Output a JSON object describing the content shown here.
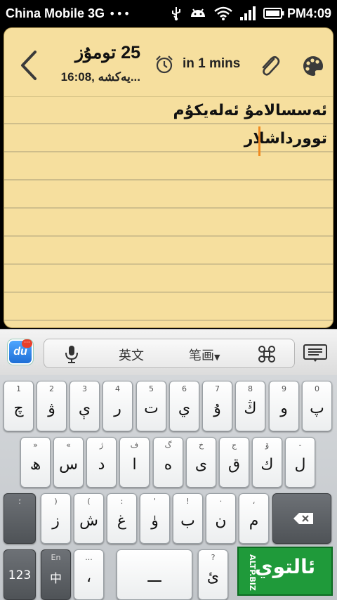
{
  "status_bar": {
    "carrier": "China Mobile 3G",
    "dots": "•••",
    "time": "PM4:09"
  },
  "note": {
    "date_day": "25 تومۇز",
    "date_sub": "16:08, يەكشە...",
    "reminder": "in 1 mins",
    "lines": [
      "ئەسسالامۇ ئەلەيكۇم",
      "توورداشلار"
    ],
    "paper_color": "#f6df9e",
    "cursor_color": "#f08a20"
  },
  "suggestion_bar": {
    "du_label": "du",
    "en_label": "英文",
    "bihua_label": "笔画"
  },
  "keyboard": {
    "row1": [
      {
        "top": "1",
        "main": "چ"
      },
      {
        "top": "2",
        "main": "ۋ"
      },
      {
        "top": "3",
        "main": "ې"
      },
      {
        "top": "4",
        "main": "ر"
      },
      {
        "top": "5",
        "main": "ت"
      },
      {
        "top": "6",
        "main": "ي"
      },
      {
        "top": "7",
        "main": "ۇ"
      },
      {
        "top": "8",
        "main": "ڭ"
      },
      {
        "top": "9",
        "main": "و"
      },
      {
        "top": "0",
        "main": "پ"
      }
    ],
    "row2": [
      {
        "top": "»",
        "main": "ھ"
      },
      {
        "top": "«",
        "main": "س"
      },
      {
        "top": "ژ",
        "main": "د"
      },
      {
        "top": "ف",
        "main": "ا"
      },
      {
        "top": "گ",
        "main": "ە"
      },
      {
        "top": "خ",
        "main": "ى"
      },
      {
        "top": "ج",
        "main": "ق"
      },
      {
        "top": "ۆ",
        "main": "ك"
      },
      {
        "top": "-",
        "main": "ل"
      }
    ],
    "row3": [
      {
        "top": "؛",
        "main": ""
      },
      {
        "top": ")",
        "main": "ز"
      },
      {
        "top": "(",
        "main": "ش"
      },
      {
        "top": ":",
        "main": "غ"
      },
      {
        "top": "'",
        "main": "ۈ"
      },
      {
        "top": "!",
        "main": "ب"
      },
      {
        "top": "·",
        "main": "ن"
      },
      {
        "top": "،",
        "main": "م"
      }
    ],
    "row4": {
      "num_label": "123",
      "lang_top": "En",
      "lang_main": "中",
      "comma_top": "...",
      "comma_main": "،",
      "space_label": "ـــ",
      "q_top": "?",
      "q_main": "ئ"
    }
  },
  "watermark": {
    "main": "ئالتوي",
    "side": "ALTP.BIZ",
    "color": "#1f9a3a"
  }
}
